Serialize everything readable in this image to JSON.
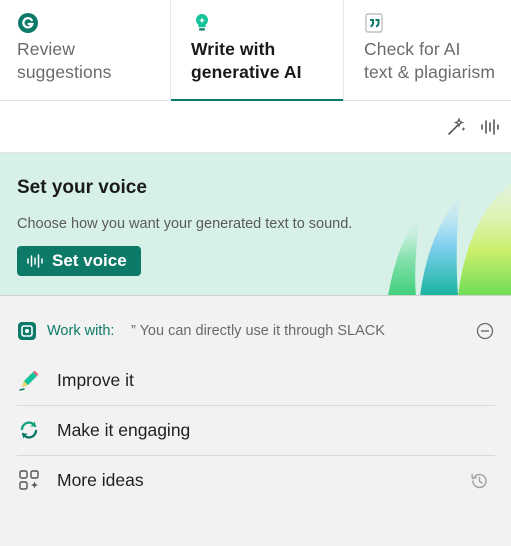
{
  "tabs": [
    {
      "label": "Review\nsuggestions",
      "icon": "grammarly-g-icon",
      "active": false
    },
    {
      "label": "Write with\ngenerative AI",
      "icon": "lightbulb-icon",
      "active": true
    },
    {
      "label": "Check for AI\ntext & plagiarism",
      "icon": "quote-icon",
      "active": false
    }
  ],
  "toolbar": {
    "icons": [
      "sparkle-icon",
      "voice-wave-icon"
    ]
  },
  "voice_banner": {
    "title": "Set your voice",
    "description": "Choose how you want your generated text to sound.",
    "button_label": "Set voice"
  },
  "work_with": {
    "label": "Work with:",
    "quote": "” You can directly use it through SLACK"
  },
  "actions": [
    {
      "label": "Improve it",
      "icon": "pencil-icon"
    },
    {
      "label": "Make it engaging",
      "icon": "refresh-icon"
    },
    {
      "label": "More ideas",
      "icon": "grid-sparkle-icon"
    }
  ],
  "colors": {
    "accent": "#0c7a68",
    "banner_bg": "#d7f1e8",
    "panel_bg": "#f2f2f2"
  }
}
